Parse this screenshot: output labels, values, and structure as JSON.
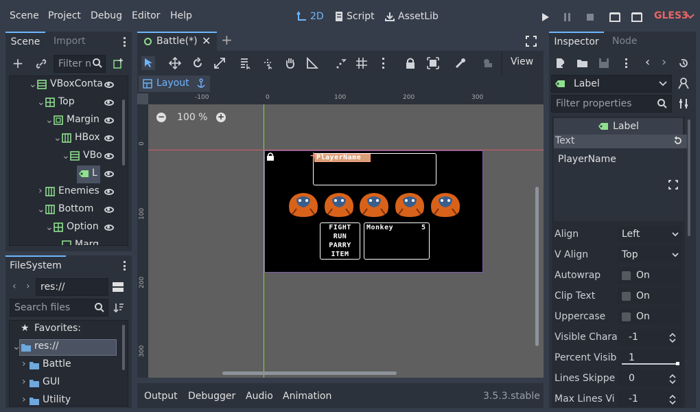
{
  "menu": {
    "scene": "Scene",
    "project": "Project",
    "debug": "Debug",
    "editor": "Editor",
    "help": "Help"
  },
  "workspaces": {
    "two_d": "2D",
    "script": "Script",
    "assetlib": "AssetLib"
  },
  "renderer": "GLES3",
  "scene_dock": {
    "tab_scene": "Scene",
    "tab_import": "Import",
    "filter_placeholder": "Filter n",
    "tree": [
      {
        "label": "VBoxConta"
      },
      {
        "label": "Top"
      },
      {
        "label": "Margin"
      },
      {
        "label": "HBox"
      },
      {
        "label": "VBo"
      },
      {
        "label": "L"
      },
      {
        "label": "Enemies"
      },
      {
        "label": "Bottom"
      },
      {
        "label": "Option"
      },
      {
        "label": "Marg"
      }
    ]
  },
  "filesystem": {
    "title": "FileSystem",
    "path": "res://",
    "search_placeholder": "Search files",
    "favorites": "Favorites:",
    "root": "res://",
    "folders": [
      "Battle",
      "GUI",
      "Utility"
    ]
  },
  "editor_tabs": {
    "battle": "Battle(*)"
  },
  "toolbar": {
    "view": "View",
    "layout": "Layout"
  },
  "zoom": "100 %",
  "ruler": {
    "h": [
      "-100",
      "0",
      "100",
      "200",
      "300"
    ],
    "v": [
      "0",
      "100",
      "200",
      "300"
    ]
  },
  "game": {
    "player_name": "PlayerName",
    "options": [
      "FIGHT",
      "RUN",
      "PARRY",
      "ITEM"
    ],
    "enemy_name": "Monkey",
    "enemy_count": "5"
  },
  "bottom_panel": {
    "output": "Output",
    "debugger": "Debugger",
    "audio": "Audio",
    "animation": "Animation",
    "version": "3.5.3.stable"
  },
  "inspector": {
    "tab_inspector": "Inspector",
    "tab_node": "Node",
    "node_type": "Label",
    "filter_placeholder": "Filter properties",
    "section": "Label",
    "text_label": "Text",
    "text_value": "PlayerName",
    "props": [
      {
        "name": "Align",
        "value": "Left"
      },
      {
        "name": "V Align",
        "value": "Top"
      },
      {
        "name": "Autowrap",
        "value": "On"
      },
      {
        "name": "Clip Text",
        "value": "On"
      },
      {
        "name": "Uppercase",
        "value": "On"
      },
      {
        "name": "Visible Chara",
        "value": "-1"
      },
      {
        "name": "Percent Visib",
        "value": "1"
      },
      {
        "name": "Lines Skippe",
        "value": "0"
      },
      {
        "name": "Max Lines Vi",
        "value": "-1"
      }
    ]
  },
  "colors": {
    "accent": "#6fb6ff",
    "renderer": "#e86666",
    "selection": "#4b5362",
    "game_bg": "#000000",
    "viewport_bg": "#5f5f5f"
  }
}
